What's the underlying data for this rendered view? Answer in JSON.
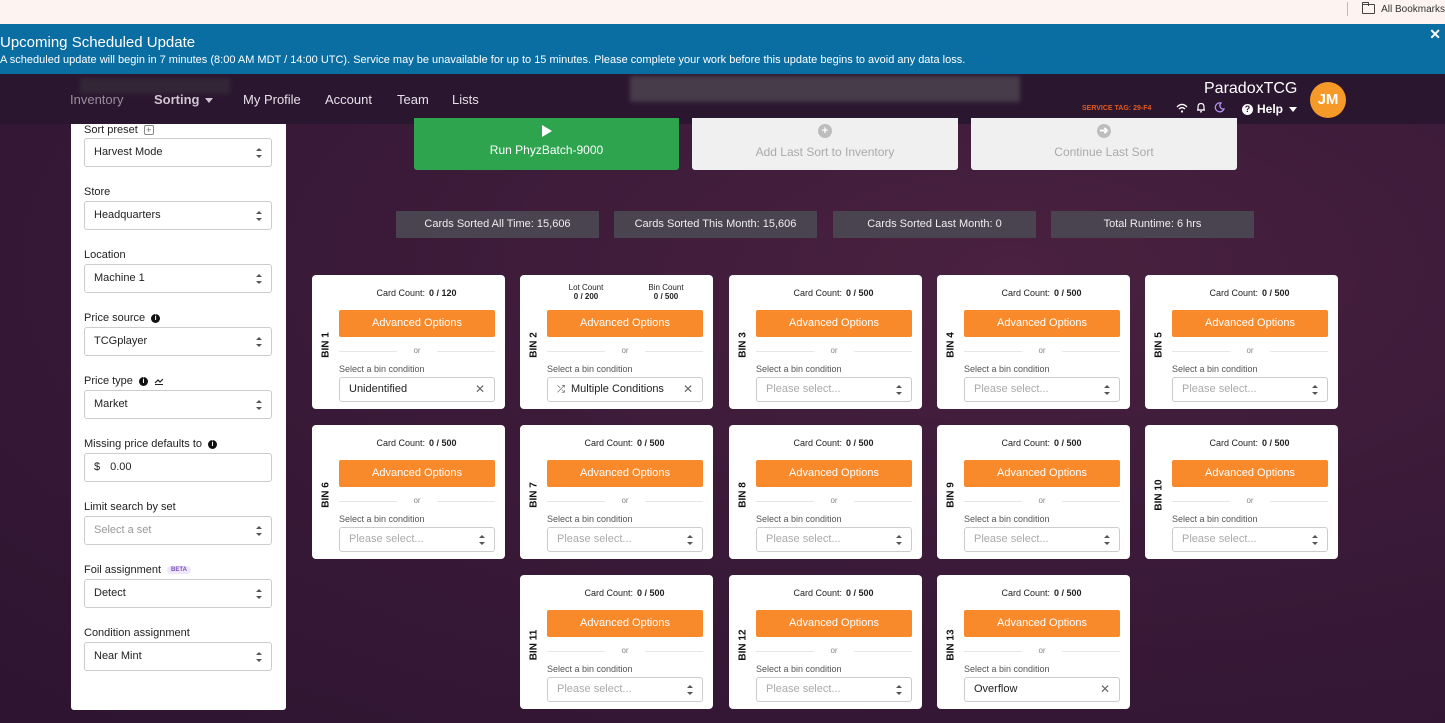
{
  "browser": {
    "bookmarks_label": "All Bookmarks"
  },
  "banner": {
    "title": "Upcoming Scheduled Update",
    "message": "A scheduled update will begin in 7 minutes (8:00 AM MDT / 14:00 UTC). Service may be unavailable for up to 15 minutes. Please complete your work before this update begins to avoid any data loss.",
    "close": "✕"
  },
  "nav": {
    "items": [
      "Inventory",
      "Sorting",
      "My Profile",
      "Account",
      "Team",
      "Lists"
    ],
    "brand": "ParadoxTCG",
    "service_tag": "SERVICE TAG: 29-F4",
    "help": "Help",
    "avatar_initials": "JM"
  },
  "sidebar": {
    "sort_preset": {
      "label": "Sort preset",
      "value": "Harvest Mode"
    },
    "store": {
      "label": "Store",
      "value": "Headquarters"
    },
    "location": {
      "label": "Location",
      "value": "Machine 1"
    },
    "price_source": {
      "label": "Price source",
      "value": "TCGplayer"
    },
    "price_type": {
      "label": "Price type",
      "value": "Market"
    },
    "missing_price": {
      "label": "Missing price defaults to",
      "currency": "$",
      "value": "0.00"
    },
    "limit_search": {
      "label": "Limit search by set",
      "placeholder": "Select a set"
    },
    "foil": {
      "label": "Foil assignment",
      "badge": "BETA",
      "value": "Detect"
    },
    "condition": {
      "label": "Condition assignment",
      "value": "Near Mint"
    }
  },
  "actions": {
    "run": "Run PhyzBatch-9000",
    "add_last": "Add Last Sort to Inventory",
    "continue_last": "Continue Last Sort"
  },
  "stats": [
    "Cards Sorted All Time: 15,606",
    "Cards Sorted This Month: 15,606",
    "Cards Sorted Last Month: 0",
    "Total Runtime: 6 hrs"
  ],
  "bin_common": {
    "card_count_label": "Card Count:",
    "lot_count_label": "Lot Count",
    "bin_count_label": "Bin Count",
    "advanced": "Advanced Options",
    "or": "or",
    "condition_label": "Select a bin condition",
    "placeholder": "Please select..."
  },
  "bins": [
    {
      "name": "BIN 1",
      "count": "0 / 120",
      "condition": "Unidentified"
    },
    {
      "name": "BIN 2",
      "lot_count": "0 / 200",
      "bin_count": "0 / 500",
      "condition": "Multiple Conditions"
    },
    {
      "name": "BIN 3",
      "count": "0 / 500",
      "condition": ""
    },
    {
      "name": "BIN 4",
      "count": "0 / 500",
      "condition": ""
    },
    {
      "name": "BIN 5",
      "count": "0 / 500",
      "condition": ""
    },
    {
      "name": "BIN 6",
      "count": "0 / 500",
      "condition": ""
    },
    {
      "name": "BIN 7",
      "count": "0 / 500",
      "condition": ""
    },
    {
      "name": "BIN 8",
      "count": "0 / 500",
      "condition": ""
    },
    {
      "name": "BIN 9",
      "count": "0 / 500",
      "condition": ""
    },
    {
      "name": "BIN 10",
      "count": "0 / 500",
      "condition": ""
    },
    {
      "name": "BIN 11",
      "count": "0 / 500",
      "condition": ""
    },
    {
      "name": "BIN 12",
      "count": "0 / 500",
      "condition": ""
    },
    {
      "name": "BIN 13",
      "count": "0 / 500",
      "condition": "Overflow"
    }
  ],
  "colors": {
    "banner": "#0a6ea2",
    "run": "#2ea44f",
    "advanced": "#f98a2c",
    "avatar": "#f59a28"
  }
}
